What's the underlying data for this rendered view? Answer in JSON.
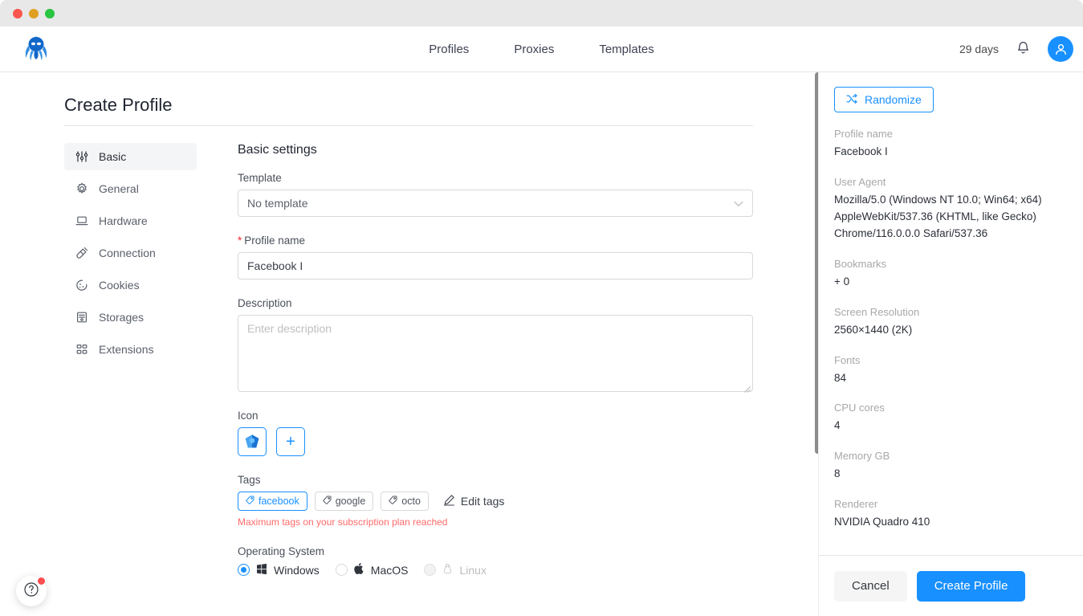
{
  "window": {
    "controls": [
      "close",
      "minimize",
      "maximize"
    ]
  },
  "topnav": {
    "logo_icon": "octopus-logo",
    "links": [
      {
        "label": "Profiles"
      },
      {
        "label": "Proxies"
      },
      {
        "label": "Templates"
      }
    ],
    "days_left": "29 days",
    "bell_icon": "bell-icon",
    "avatar_icon": "user-avatar-icon"
  },
  "page": {
    "title": "Create Profile"
  },
  "sidebar": {
    "items": [
      {
        "label": "Basic",
        "icon": "sliders-icon",
        "active": true
      },
      {
        "label": "General",
        "icon": "gear-icon",
        "active": false
      },
      {
        "label": "Hardware",
        "icon": "laptop-icon",
        "active": false
      },
      {
        "label": "Connection",
        "icon": "plug-icon",
        "active": false
      },
      {
        "label": "Cookies",
        "icon": "cookie-icon",
        "active": false
      },
      {
        "label": "Storages",
        "icon": "database-icon",
        "active": false
      },
      {
        "label": "Extensions",
        "icon": "grid-icon",
        "active": false
      }
    ]
  },
  "form": {
    "section_title": "Basic settings",
    "template": {
      "label": "Template",
      "value": "No template",
      "chevron_icon": "chevron-down-icon"
    },
    "profile_name": {
      "required_marker": "*",
      "label": "Profile name",
      "value": "Facebook I"
    },
    "description": {
      "label": "Description",
      "placeholder": "Enter description",
      "value": ""
    },
    "icon": {
      "label": "Icon",
      "selected_icon": "octo-shield-icon",
      "add_label": "+"
    },
    "tags": {
      "label": "Tags",
      "items": [
        {
          "label": "facebook",
          "selected": true
        },
        {
          "label": "google",
          "selected": false
        },
        {
          "label": "octo",
          "selected": false
        }
      ],
      "edit_label": "Edit tags",
      "edit_icon": "pencil-icon",
      "warning": "Maximum tags on your subscription plan reached"
    },
    "operating_system": {
      "label": "Operating System",
      "options": [
        {
          "label": "Windows",
          "icon": "windows-icon",
          "selected": true,
          "disabled": false
        },
        {
          "label": "MacOS",
          "icon": "apple-icon",
          "selected": false,
          "disabled": false
        },
        {
          "label": "Linux",
          "icon": "linux-icon",
          "selected": false,
          "disabled": true
        }
      ]
    }
  },
  "preview": {
    "randomize_label": "Randomize",
    "randomize_icon": "shuffle-icon",
    "fields": [
      {
        "label": "Profile name",
        "value": "Facebook I"
      },
      {
        "label": "User Agent",
        "value": "Mozilla/5.0 (Windows NT 10.0; Win64; x64) AppleWebKit/537.36 (KHTML, like Gecko) Chrome/116.0.0.0 Safari/537.36"
      },
      {
        "label": "Bookmarks",
        "value": "+ 0"
      },
      {
        "label": "Screen Resolution",
        "value": "2560×1440 (2K)"
      },
      {
        "label": "Fonts",
        "value": "84"
      },
      {
        "label": "CPU cores",
        "value": "4"
      },
      {
        "label": "Memory GB",
        "value": "8"
      },
      {
        "label": "Renderer",
        "value": "NVIDIA Quadro 410"
      }
    ],
    "cancel_label": "Cancel",
    "create_label": "Create Profile"
  },
  "help": {
    "icon": "question-circle-icon",
    "has_notification": true
  },
  "colors": {
    "accent": "#1890ff",
    "danger": "#ff6b6b",
    "required": "#f5222d",
    "titlebar": "#e8e8e8"
  }
}
